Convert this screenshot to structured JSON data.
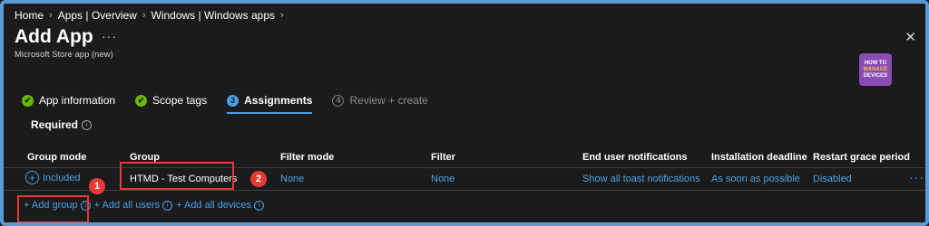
{
  "breadcrumb": [
    "Home",
    "Apps | Overview",
    "Windows | Windows apps"
  ],
  "header": {
    "title": "Add App",
    "more": "···",
    "subtitle": "Microsoft Store app (new)",
    "close": "✕"
  },
  "logo": {
    "line1": "HOW TO",
    "line2": "MANAGE",
    "line3": "DEVICES"
  },
  "tabs": [
    {
      "label": "App information",
      "state": "done",
      "icon": "✔"
    },
    {
      "label": "Scope tags",
      "state": "done",
      "icon": "✔"
    },
    {
      "label": "Assignments",
      "state": "current",
      "icon": "3"
    },
    {
      "label": "Review + create",
      "state": "todo",
      "icon": "4"
    }
  ],
  "section": {
    "label": "Required"
  },
  "grid": {
    "columns": [
      "Group mode",
      "Group",
      "Filter mode",
      "Filter",
      "End user notifications",
      "Installation deadline",
      "Restart grace period"
    ],
    "row": {
      "group_mode": "Included",
      "group": "HTMD - Test Computers",
      "filter_mode": "None",
      "filter": "None",
      "notifications": "Show all toast notifications",
      "deadline": "As soon as possible",
      "restart": "Disabled",
      "more": "···"
    }
  },
  "add_links": {
    "add_group": "+ Add group",
    "add_users": "+ Add all users",
    "add_devices": "+ Add all devices"
  },
  "badges": {
    "one": "1",
    "two": "2"
  },
  "colors": {
    "accent": "#4aa0e6",
    "success": "#6bb700",
    "highlight": "#e53935",
    "frame": "#5b9bd5"
  }
}
